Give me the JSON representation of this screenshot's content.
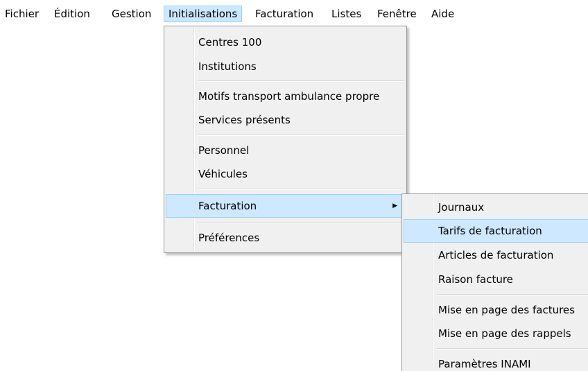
{
  "menubar": {
    "items": [
      {
        "label": "Fichier"
      },
      {
        "label": "Édition"
      },
      {
        "label": "Gestion"
      },
      {
        "label": "Initialisations"
      },
      {
        "label": "Facturation"
      },
      {
        "label": "Listes"
      },
      {
        "label": "Fenêtre"
      },
      {
        "label": "Aide"
      }
    ]
  },
  "initialisations_menu": {
    "items": [
      {
        "label": "Centres 100"
      },
      {
        "label": "Institutions"
      },
      {
        "label": "Motifs transport ambulance propre"
      },
      {
        "label": "Services présents"
      },
      {
        "label": "Personnel"
      },
      {
        "label": "Véhicules"
      },
      {
        "label": "Facturation"
      },
      {
        "label": "Préférences"
      }
    ],
    "submenu_arrow_icon": "chevron-right-icon",
    "submenu_arrow_glyph": "▶"
  },
  "facturation_submenu": {
    "items": [
      {
        "label": "Journaux"
      },
      {
        "label": "Tarifs de facturation"
      },
      {
        "label": "Articles de facturation"
      },
      {
        "label": "Raison facture"
      },
      {
        "label": "Mise en page des factures"
      },
      {
        "label": "Mise en page des rappels"
      },
      {
        "label": "Paramètres INAMI"
      }
    ]
  },
  "colors": {
    "highlight_bg": "#cde8ff",
    "highlight_border": "#99d1ff",
    "menu_bg": "#f0f0f0"
  }
}
